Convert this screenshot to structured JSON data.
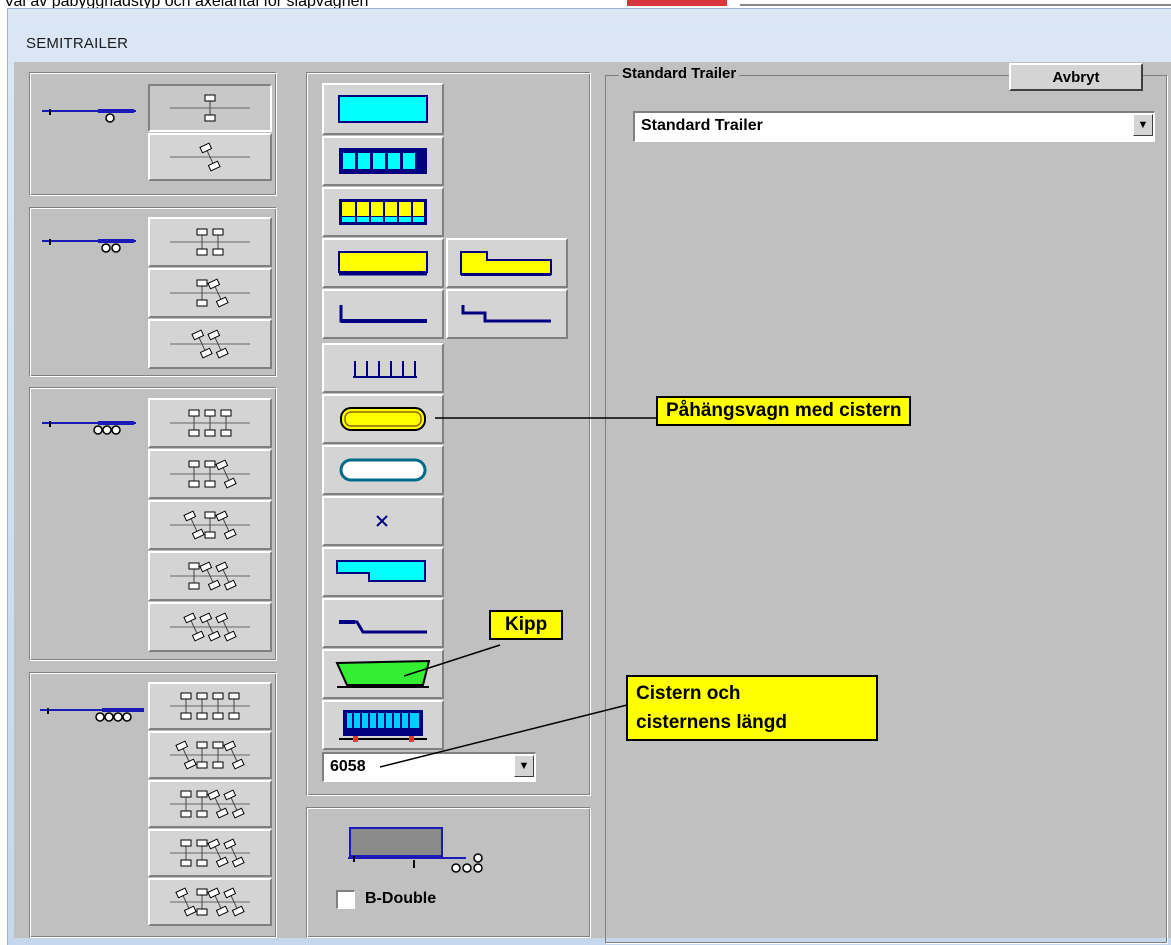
{
  "caption": "Val av påbyggnadstyp och axelantal för släpvagnen",
  "window": {
    "title": "SEMITRAILER"
  },
  "body_combo": {
    "value": "6058"
  },
  "bdouble": {
    "label": "B-Double",
    "checked": false
  },
  "right_panel": {
    "group_label": "Standard Trailer",
    "cancel_label": "Avbryt",
    "type_select_value": "Standard Trailer"
  },
  "callouts": {
    "tank": "Påhängsvagn med cistern",
    "tipper": "Kipp",
    "cistern_length_line1": "Cistern och",
    "cistern_length_line2": "cisternens längd"
  },
  "colors": {
    "cyan": "#00ffff",
    "yellow": "#ffff00",
    "green": "#33ee33",
    "blue_outline": "#000080",
    "trailer_blue": "#1a1ab8",
    "callout": "#ffff00"
  }
}
